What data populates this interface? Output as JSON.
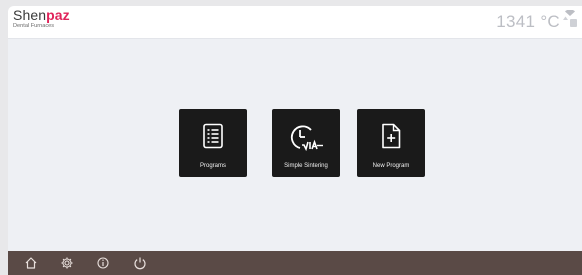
{
  "brand": {
    "name_part1": "Shen",
    "name_part2": "paz",
    "subtitle": "Dental Furnaces",
    "accent_color": "#e0245b"
  },
  "header": {
    "temperature": "1341 °C",
    "status_icons": [
      "thermometer-icon",
      "wifi-icon"
    ]
  },
  "tiles": [
    {
      "label": "Programs",
      "icon": "list-document-icon"
    },
    {
      "label": "Simple Sintering",
      "icon": "clock-via-icon"
    },
    {
      "label": "New Program",
      "icon": "new-document-icon"
    }
  ],
  "bottom_nav": {
    "background": "#5a4a46",
    "items": [
      "home-icon",
      "settings-gear-icon",
      "info-icon",
      "power-icon"
    ]
  }
}
